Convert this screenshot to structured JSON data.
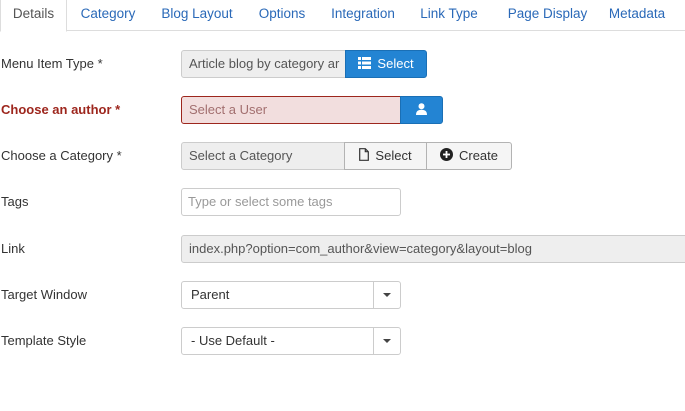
{
  "tabs": [
    "Details",
    "Category",
    "Blog Layout",
    "Options",
    "Integration",
    "Link Type",
    "Page Display",
    "Metadata"
  ],
  "form": {
    "menu_item_type": {
      "label": "Menu Item Type *",
      "value": "Article blog by category ar",
      "button": "Select"
    },
    "author": {
      "label": "Choose an author *",
      "placeholder": "Select a User"
    },
    "category": {
      "label": "Choose a Category *",
      "value": "Select a Category",
      "select_button": "Select",
      "create_button": "Create"
    },
    "tags": {
      "label": "Tags",
      "placeholder": "Type or select some tags"
    },
    "link": {
      "label": "Link",
      "value": "index.php?option=com_author&view=category&layout=blog"
    },
    "target_window": {
      "label": "Target Window",
      "value": "Parent"
    },
    "template_style": {
      "label": "Template Style",
      "value": "- Use Default -"
    }
  },
  "colors": {
    "primary": "#2384d3",
    "tab_link": "#2a69b8",
    "invalid": "#9d261d",
    "invalid_bg": "#f2dede"
  }
}
